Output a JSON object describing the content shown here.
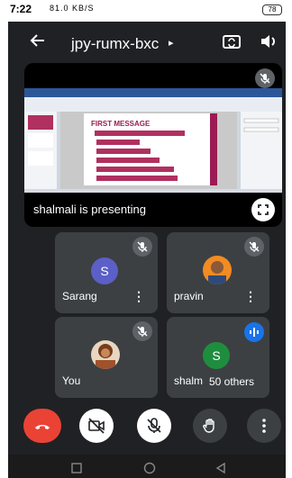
{
  "status_bar": {
    "time": "7:22",
    "network": "81.0 KB/S",
    "battery": "78"
  },
  "meeting": {
    "code": "jpy-rumx-bxc",
    "caret": "▸"
  },
  "icons": {
    "back": "arrow-left-icon",
    "camera_switch": "camera-switch-icon",
    "audio": "speaker-icon",
    "mute": "mic-off-icon",
    "fullscreen": "fullscreen-icon",
    "end_call": "phone-hangup-icon",
    "camera_off": "video-off-icon",
    "mic_off": "mic-off-icon",
    "raise_hand": "hand-icon",
    "more": "more-vert-icon"
  },
  "presentation": {
    "caption": "shalmali is presenting",
    "slide_title": "FIRST MESSAGE"
  },
  "participants": [
    {
      "name": "Sarang",
      "initial": "S",
      "avatar_color": "#5b5fc7"
    },
    {
      "name": "pravin"
    },
    {
      "name": "You"
    },
    {
      "name": "shalmali",
      "initial": "S",
      "avatar_color": "#1e8e3e"
    }
  ],
  "others": "50 others",
  "colors": {
    "background": "#202124",
    "tile": "#3c4043",
    "end_call": "#ea4335",
    "speaking": "#1a73e8"
  }
}
